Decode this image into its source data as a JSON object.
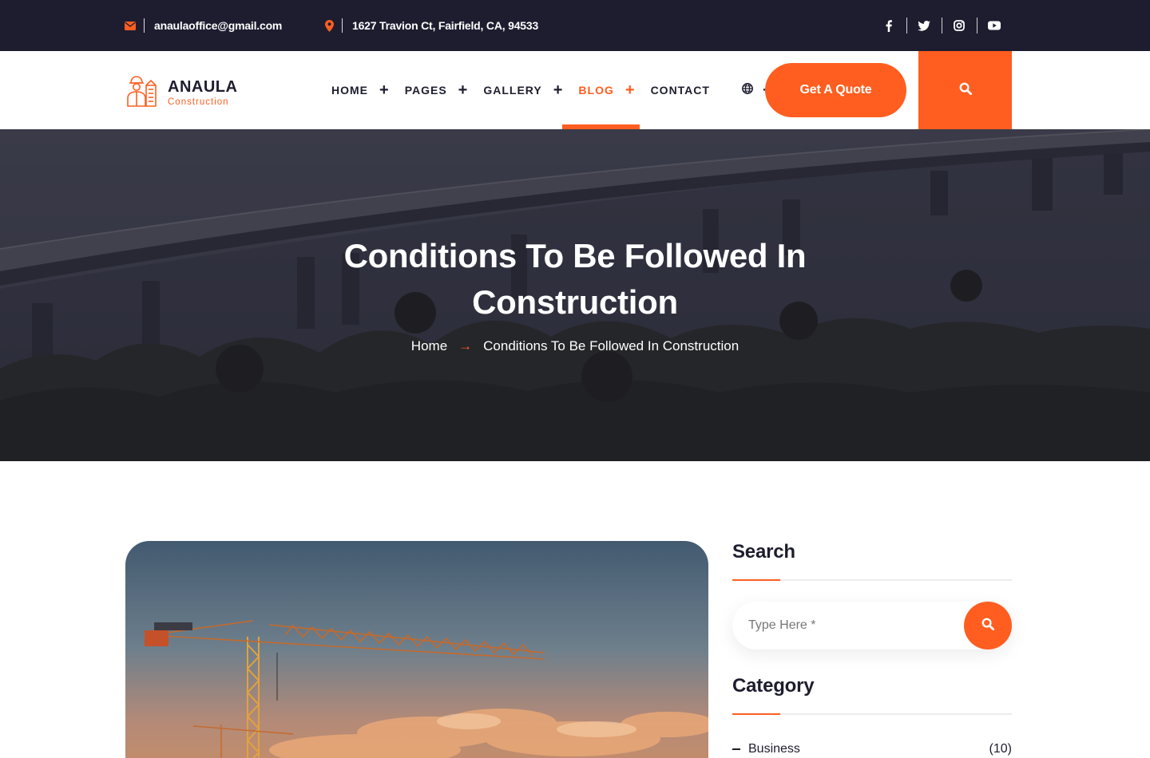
{
  "topbar": {
    "email": "anaulaoffice@gmail.com",
    "address": "1627 Travion Ct, Fairfield, CA, 94533",
    "social": [
      "facebook-icon",
      "twitter-icon",
      "instagram-icon",
      "youtube-icon"
    ]
  },
  "brand": {
    "name": "ANAULA",
    "tagline": "Construction"
  },
  "nav": {
    "items": [
      {
        "label": "HOME",
        "plus": "+"
      },
      {
        "label": "PAGES",
        "plus": "+"
      },
      {
        "label": "GALLERY",
        "plus": "+"
      },
      {
        "label": "BLOG",
        "plus": "+"
      },
      {
        "label": "CONTACT"
      }
    ],
    "active": "BLOG",
    "language_plus": "+",
    "quote_button": "Get A Quote"
  },
  "hero": {
    "title_line1": "Conditions To Be Followed In",
    "title_line2": "Construction",
    "breadcrumb_home": "Home",
    "breadcrumb_arrow": "→",
    "breadcrumb_current": "Conditions To Be Followed In Construction"
  },
  "sidebar": {
    "search_title": "Search",
    "search_placeholder": "Type Here *",
    "category_title": "Category",
    "categories": [
      {
        "name": "Business",
        "count": "(10)"
      }
    ]
  },
  "colors": {
    "accent": "#ff5e20",
    "dark": "#1e1d2f"
  }
}
